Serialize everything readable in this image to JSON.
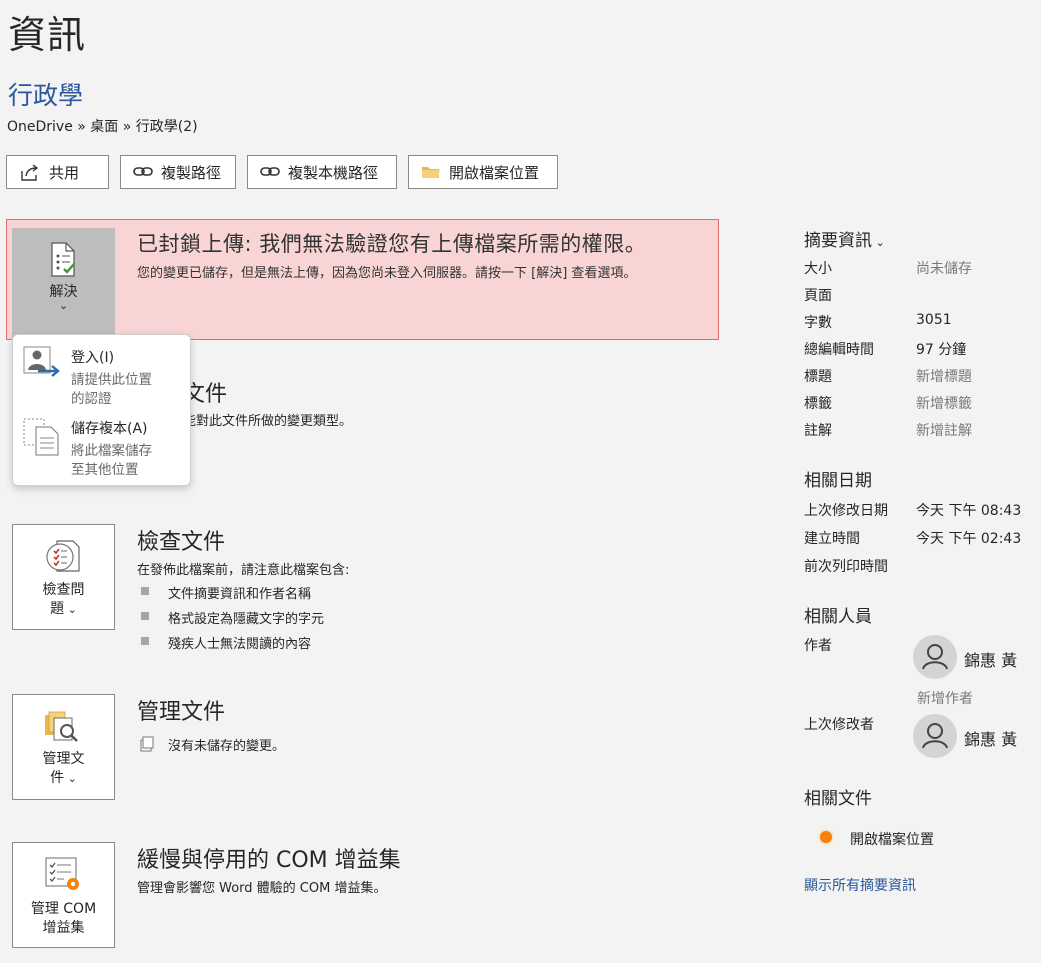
{
  "page": {
    "title": "資訊",
    "doc_title": "行政學",
    "breadcrumb": "OneDrive » 桌面 » 行政學(2)"
  },
  "toolbar": {
    "share": "共用",
    "copy_path": "複製路徑",
    "copy_local_path": "複製本機路徑",
    "open_location": "開啟檔案位置"
  },
  "warning": {
    "title": "已封鎖上傳: 我們無法驗證您有上傳檔案所需的權限。",
    "description": "您的變更已儲存，但是無法上傳，因為您尚未登入伺服器。請按一下 [解決] 查看選項。",
    "resolve_label": "解決",
    "bg_color": "#f8d4d4",
    "border_color": "#e06b6b"
  },
  "resolve_menu": {
    "items": [
      {
        "title": "登入(I)",
        "desc_line1": "請提供此位置",
        "desc_line2": "的認證"
      },
      {
        "title": "儲存複本(A)",
        "desc_line1": "將此檔案儲存",
        "desc_line2": "至其他位置"
      }
    ]
  },
  "protect": {
    "title_partial": "文件",
    "text_partial": "能對此文件所做的變更類型。"
  },
  "inspect": {
    "btn_line1": "檢查問",
    "btn_line2": "題",
    "title": "檢查文件",
    "intro": "在發佈此檔案前，請注意此檔案包含:",
    "bullets": [
      "文件摘要資訊和作者名稱",
      "格式設定為隱藏文字的字元",
      "殘疾人士無法閱讀的內容"
    ]
  },
  "manage": {
    "btn_line1": "管理文",
    "btn_line2": "件",
    "title": "管理文件",
    "text": "沒有未儲存的變更。"
  },
  "com": {
    "btn_line1": "管理 COM",
    "btn_line2": "增益集",
    "title": "緩慢與停用的 COM 增益集",
    "text": "管理會影響您 Word 體驗的 COM 增益集。"
  },
  "properties": {
    "heading": "摘要資訊",
    "rows": [
      {
        "label": "大小",
        "value": "尚未儲存",
        "muted": true
      },
      {
        "label": "頁面",
        "value": "",
        "muted": false
      },
      {
        "label": "字數",
        "value": "3051",
        "muted": false
      },
      {
        "label": "總編輯時間",
        "value": "97 分鐘",
        "muted": false
      },
      {
        "label": "標題",
        "value": "新增標題",
        "muted": true
      },
      {
        "label": "標籤",
        "value": "新增標籤",
        "muted": true
      },
      {
        "label": "註解",
        "value": "新增註解",
        "muted": true
      }
    ]
  },
  "dates": {
    "heading": "相關日期",
    "rows": [
      {
        "label": "上次修改日期",
        "value": "今天 下午 08:43"
      },
      {
        "label": "建立時間",
        "value": "今天 下午 02:43"
      },
      {
        "label": "前次列印時間",
        "value": ""
      }
    ]
  },
  "people": {
    "heading": "相關人員",
    "author_label": "作者",
    "author_name": "錦惠 黃",
    "add_author": "新增作者",
    "modified_label": "上次修改者",
    "modified_name": "錦惠 黃"
  },
  "related_docs": {
    "heading": "相關文件",
    "open_location": "開啟檔案位置",
    "show_all": "顯示所有摘要資訊"
  },
  "colors": {
    "accent": "#2b579a",
    "background": "#f3f3f3",
    "orange_dot": "#f5820a"
  }
}
